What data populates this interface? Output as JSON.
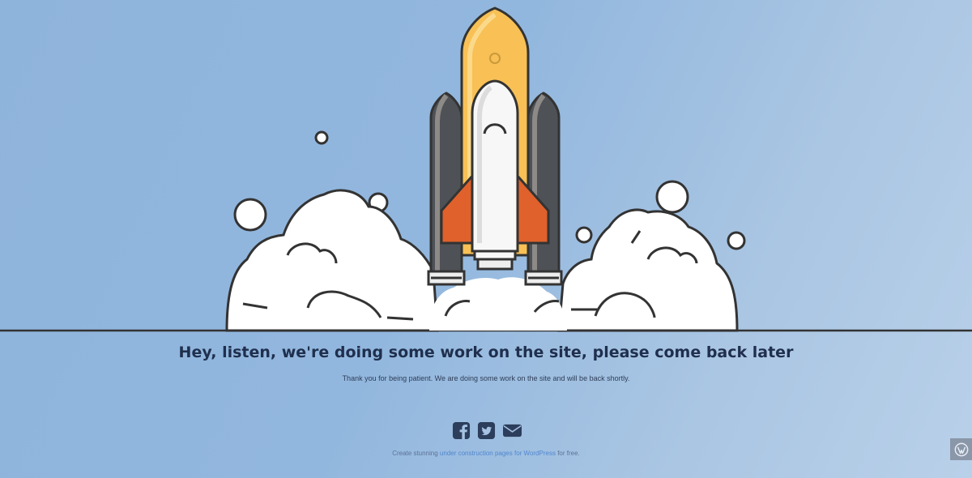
{
  "page": {
    "headline": "Hey, listen, we're doing some work on the site, please come back later",
    "subtext": "Thank you for being patient. We are doing some work on the site and will be back shortly."
  },
  "social": {
    "icons": [
      "facebook-icon",
      "twitter-icon",
      "email-icon"
    ]
  },
  "footer": {
    "prefix": "Create stunning",
    "link_text": "under construction pages for WordPress",
    "suffix": "for free."
  },
  "colors": {
    "accent_text": "#1f2f4d",
    "link": "#4f86cf",
    "rocket_orange": "#e0612b",
    "rocket_yellow": "#f8c055",
    "booster_gray": "#555a60"
  }
}
